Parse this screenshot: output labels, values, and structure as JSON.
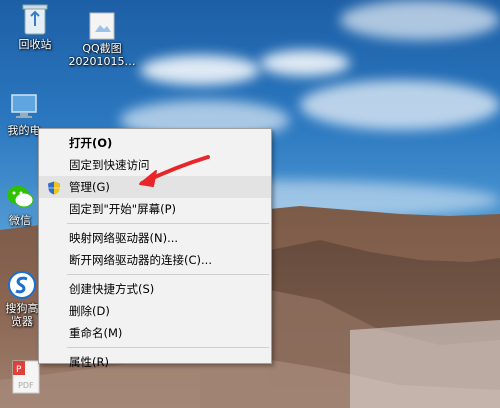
{
  "desktop": {
    "icons": [
      {
        "label": "回收站",
        "icon": "recycle-bin-icon"
      },
      {
        "label": "QQ截图\n20201015…",
        "icon": "image-file-icon"
      },
      {
        "label": "我的电",
        "icon": "computer-icon"
      },
      {
        "label": "微信",
        "icon": "wechat-icon"
      },
      {
        "label": "搜狗高\n览器",
        "icon": "sogou-browser-icon"
      },
      {
        "label": "PDF",
        "icon": "pdf-icon"
      }
    ]
  },
  "context_menu": {
    "items": [
      {
        "label": "打开(O)",
        "bold": true
      },
      {
        "label": "固定到快速访问"
      },
      {
        "label": "管理(G)",
        "icon": "shield-icon",
        "highlighted": true
      },
      {
        "label": "固定到\"开始\"屏幕(P)"
      },
      {
        "label": "映射网络驱动器(N)..."
      },
      {
        "label": "断开网络驱动器的连接(C)..."
      },
      {
        "label": "创建快捷方式(S)"
      },
      {
        "label": "删除(D)"
      },
      {
        "label": "重命名(M)"
      },
      {
        "label": "属性(R)"
      }
    ]
  },
  "annotation": {
    "arrow_color": "#e8262a"
  }
}
